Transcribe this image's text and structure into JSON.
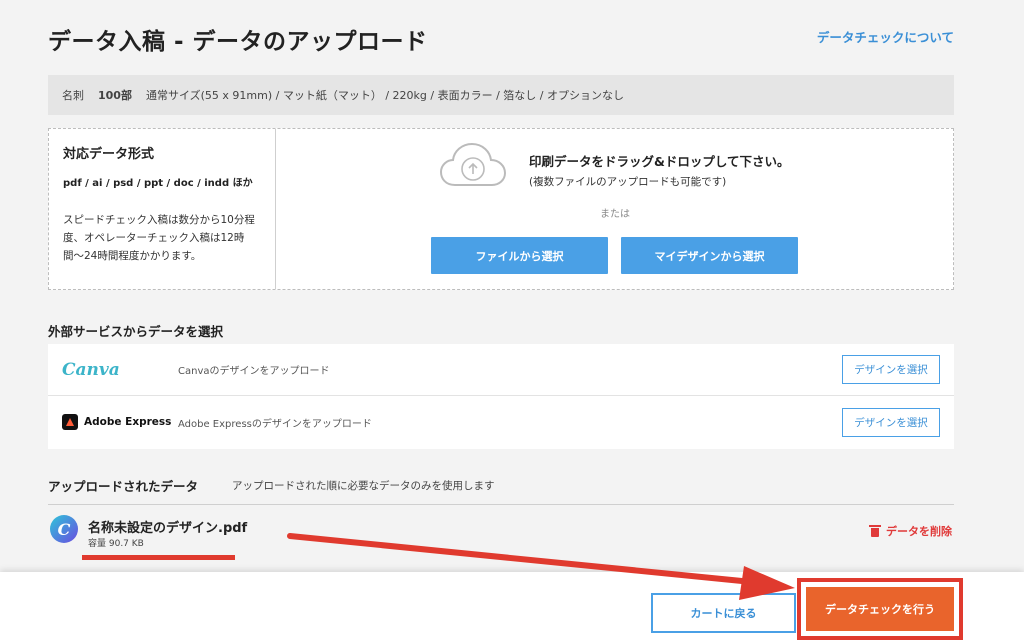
{
  "header": {
    "title": "データ入稿 - データのアップロード",
    "help_link": "データチェックについて"
  },
  "spec": {
    "item": "名刺",
    "qty": "100部",
    "details": "通常サイズ(55 x 91mm) / マット紙（マット） / 220kg / 表面カラー / 箔なし / オプションなし"
  },
  "formats": {
    "title": "対応データ形式",
    "extensions": "pdf / ai / psd / ppt / doc / indd ほか",
    "note": "スピードチェック入稿は数分から10分程度、オペレーターチェック入稿は12時間〜24時間程度かかります。"
  },
  "dropzone": {
    "main": "印刷データをドラッグ&ドロップして下さい。",
    "sub": "(複数ファイルのアップロードも可能です)",
    "or": "または",
    "file_button": "ファイルから選択",
    "mydesign_button": "マイデザインから選択"
  },
  "external": {
    "title": "外部サービスからデータを選択",
    "services": [
      {
        "logo": "Canva",
        "desc": "Canvaのデザインをアップロード",
        "button": "デザインを選択"
      },
      {
        "logo": "Adobe Express",
        "desc": "Adobe Expressのデザインをアップロード",
        "button": "デザインを選択"
      }
    ]
  },
  "uploaded": {
    "title": "アップロードされたデータ",
    "note": "アップロードされた順に必要なデータのみを使用します",
    "files": [
      {
        "icon": "C",
        "name": "名称未設定のデザイン.pdf",
        "size": "容量 90.7 KB",
        "delete_label": "データを削除"
      }
    ]
  },
  "footer": {
    "back_button": "カートに戻る",
    "check_button": "データチェックを行う"
  },
  "colors": {
    "accent_blue": "#4aa0e6",
    "cta_orange": "#e9642c",
    "annotation_red": "#e03a2e",
    "delete_red": "#e03a3a"
  }
}
